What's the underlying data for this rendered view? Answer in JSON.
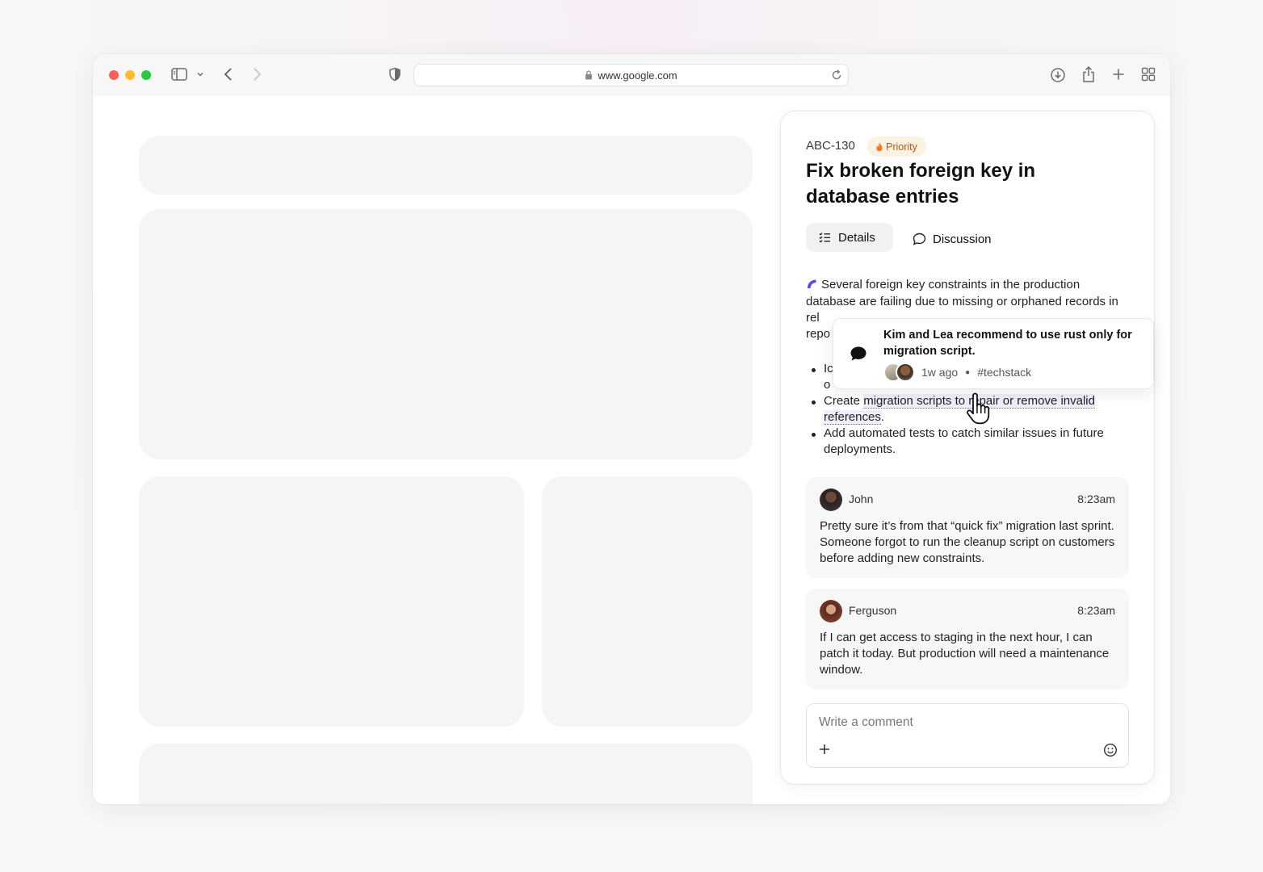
{
  "browser": {
    "url": "www.google.com",
    "icons": [
      "sidebar-icon",
      "chevron-down-icon",
      "back-icon",
      "forward-icon",
      "shield-icon",
      "lock-icon",
      "reload-icon",
      "download-icon",
      "share-icon",
      "plus-icon",
      "tabs-overview-icon"
    ]
  },
  "issue": {
    "id": "ABC-130",
    "priority": "Priority",
    "title": "Fix broken foreign key in database entries",
    "tabs": {
      "details": "Details",
      "discussion": "Discussion"
    },
    "description_visible_start": "Several foreign key constraints in the production database are failing due to missing or orphaned records in rel",
    "description_line4_prefix": "repo",
    "bullet1_prefix_line1": "Ic",
    "bullet1_prefix_line2": "o",
    "bullet2_text": "Create ",
    "bullet2_link": "migration scripts to repair or remove invalid references",
    "bullet2_end": ".",
    "bullet3_text": "Add automated tests to catch similar issues in future deployments."
  },
  "popover": {
    "text": "Kim and Lea recommend to use rust only for migration script.",
    "time": "1w ago",
    "tag": "#techstack"
  },
  "comments": [
    {
      "author": "John",
      "time": "8:23am",
      "body": "Pretty sure it’s from that “quick fix” migration last sprint. Someone forgot to run the cleanup script on customers before adding new constraints."
    },
    {
      "author": "Ferguson",
      "time": "8:23am",
      "body": "If I can get access to staging in the next hour, I can patch it today. But production will need a maintenance window."
    }
  ],
  "composer": {
    "placeholder": "Write a comment"
  },
  "colors": {
    "priority_bg": "#fdf1e3",
    "priority_text": "#b45a12",
    "link_highlight": "#eeeefc",
    "link_underline": "#6a63d8",
    "ai_accent": "#5a4be6"
  }
}
